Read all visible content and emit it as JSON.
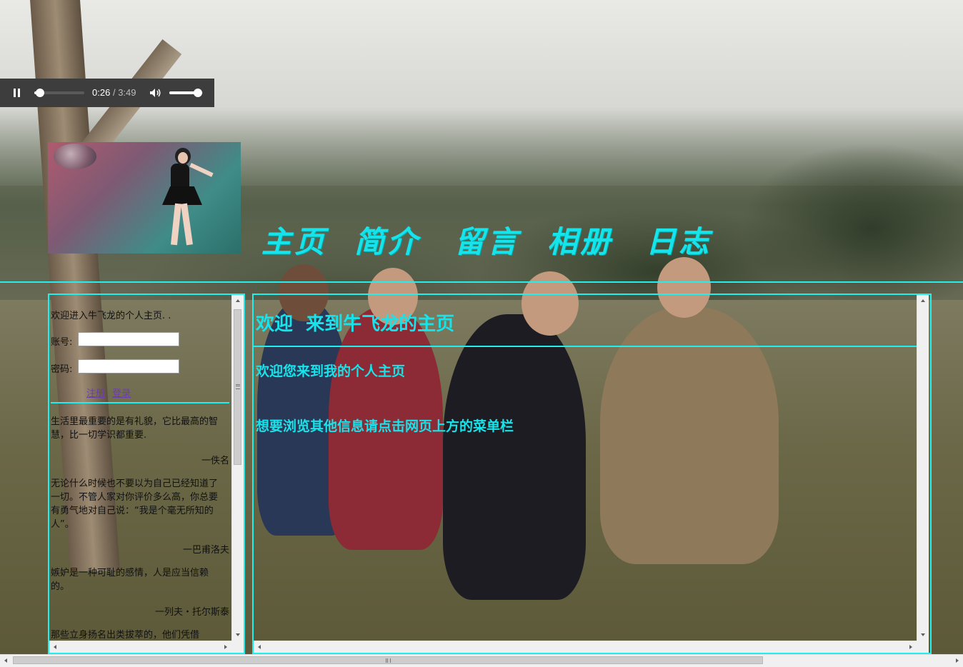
{
  "player": {
    "current_time": "0:26",
    "separator": "/",
    "duration": "3:49",
    "progress": 0.113,
    "volume": 0.85
  },
  "nav": {
    "items": [
      "主页",
      "简介",
      "留言",
      "相册",
      "日志"
    ]
  },
  "sidebar": {
    "welcome": "欢迎进入牛飞龙的个人主页. .",
    "account_label": "账号:",
    "account_value": "",
    "password_label": "密码:",
    "password_value": "",
    "register_link": "注册",
    "login_link": "登录",
    "quotes": [
      {
        "text": "生活里最重要的是有礼貌，它比最高的智慧，比一切学识都重要.",
        "author": "一佚名"
      },
      {
        "text": "无论什么时候也不要以为自己已经知道了一切。不管人家对你评价多么高，你总要有勇气地对自己说：“我是个毫无所知的人”。",
        "author": "一巴甫洛夫"
      },
      {
        "text": "嫉妒是一种可耻的感情，人是应当信赖的。",
        "author": "一列夫・托尔斯泰"
      },
      {
        "text": "那些立身扬名出类拔萃的，他们凭借",
        "author": ""
      }
    ]
  },
  "main": {
    "title": "欢迎  来到牛飞龙的主页",
    "line1": "欢迎您来到我的个人主页",
    "line2": "想要浏览其他信息请点击网页上方的菜单栏"
  },
  "colors": {
    "accent": "#17e3ea",
    "player_bg": "#3d3d3d",
    "link": "#6b3ea8"
  },
  "icons": {
    "pause": "pause-icon",
    "volume": "volume-icon"
  }
}
